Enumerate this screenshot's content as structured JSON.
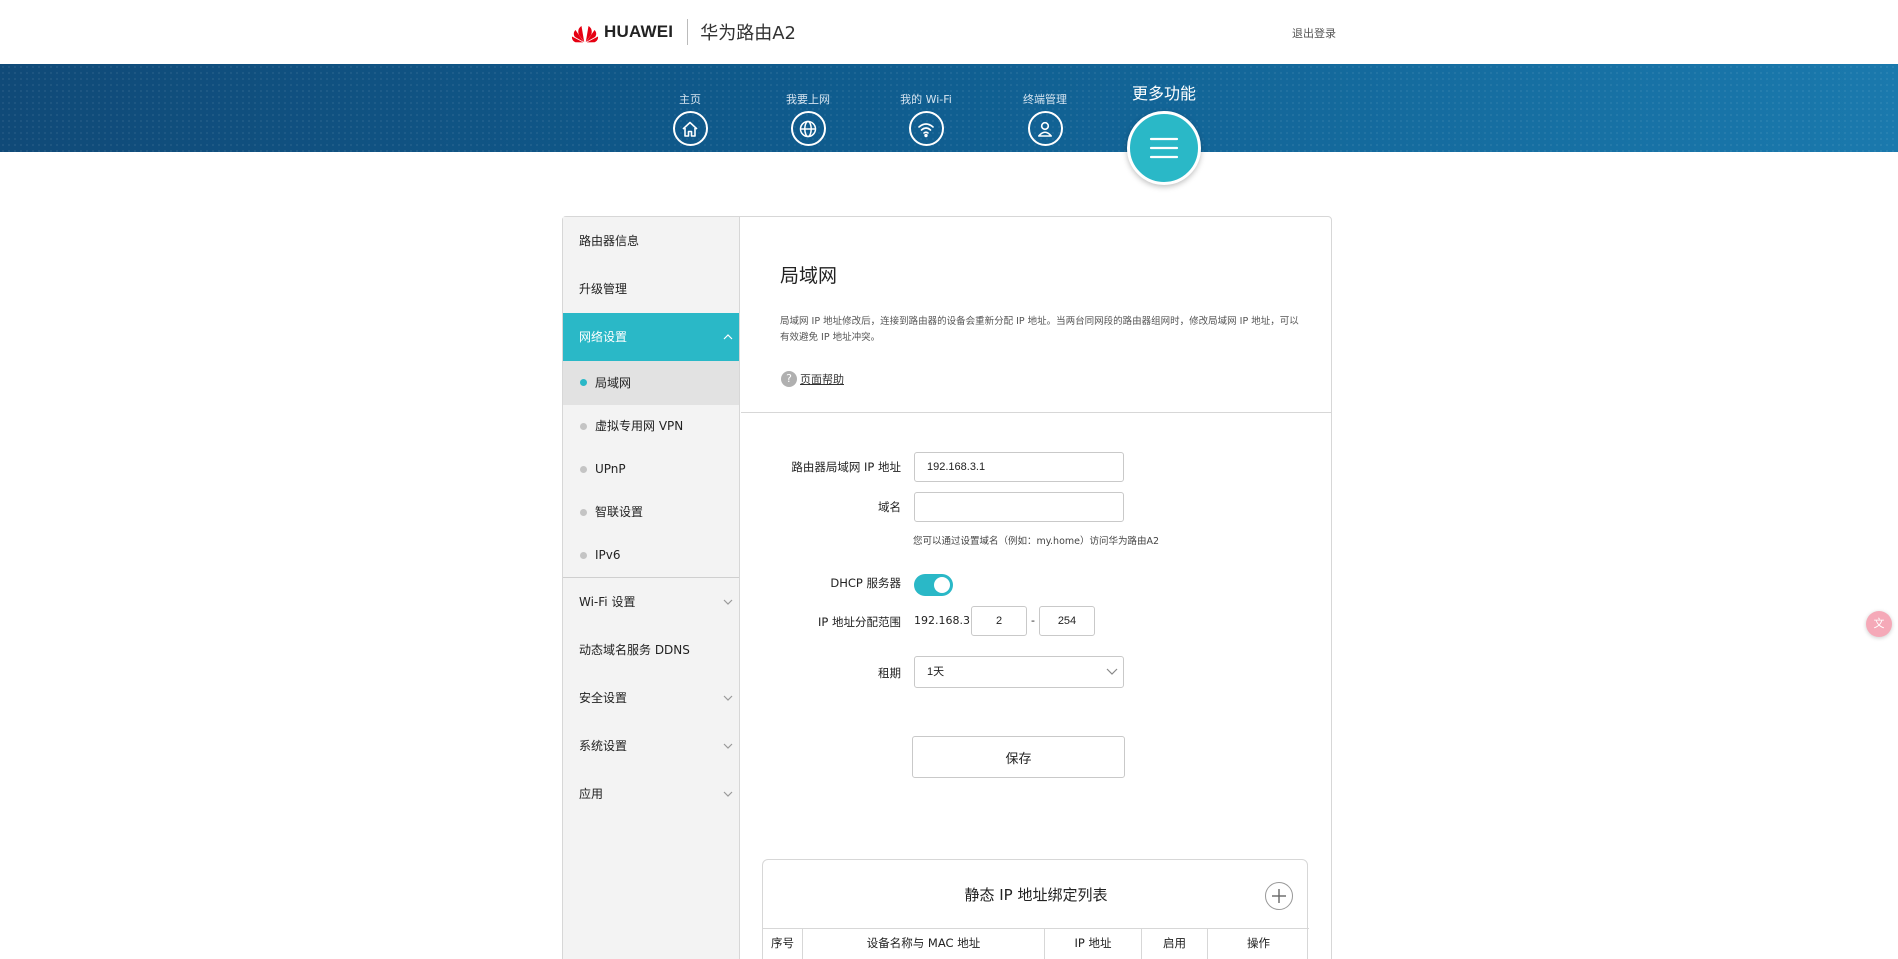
{
  "header": {
    "brand": "HUAWEI",
    "model": "华为路由A2",
    "logout": "退出登录"
  },
  "nav": {
    "items": [
      {
        "label": "主页",
        "icon": "home-icon"
      },
      {
        "label": "我要上网",
        "icon": "globe-icon"
      },
      {
        "label": "我的 Wi-Fi",
        "icon": "wifi-icon"
      },
      {
        "label": "终端管理",
        "icon": "user-icon"
      }
    ],
    "more": {
      "label": "更多功能",
      "icon": "menu-icon"
    }
  },
  "sidebar": {
    "items": [
      {
        "label": "路由器信息"
      },
      {
        "label": "升级管理"
      },
      {
        "label": "网络设置",
        "expanded": true
      },
      {
        "label": "Wi-Fi 设置"
      },
      {
        "label": "动态域名服务 DDNS"
      },
      {
        "label": "安全设置"
      },
      {
        "label": "系统设置"
      },
      {
        "label": "应用"
      }
    ],
    "subitems": [
      {
        "label": "局域网",
        "current": true
      },
      {
        "label": "虚拟专用网 VPN"
      },
      {
        "label": "UPnP"
      },
      {
        "label": "智联设置"
      },
      {
        "label": "IPv6"
      }
    ]
  },
  "main": {
    "title": "局域网",
    "description": "局域网 IP 地址修改后，连接到路由器的设备会重新分配 IP 地址。当两台同网段的路由器组网时，修改局域网 IP 地址，可以有效避免 IP 地址冲突。",
    "help": "页面帮助",
    "form": {
      "ip_label": "路由器局域网 IP 地址",
      "ip_value": "192.168.3.1",
      "domain_label": "域名",
      "domain_value": "",
      "domain_hint": "您可以通过设置域名（例如：my.home）访问华为路由A2",
      "dhcp_label": "DHCP 服务器",
      "dhcp_enabled": true,
      "range_label": "IP 地址分配范围",
      "range_prefix": "192.168.3.",
      "range_start": "2",
      "range_sep": "-",
      "range_end": "254",
      "lease_label": "租期",
      "lease_value": "1天",
      "save": "保存"
    },
    "static_table": {
      "title": "静态 IP 地址绑定列表",
      "columns": [
        "序号",
        "设备名称与 MAC 地址",
        "IP 地址",
        "启用",
        "操作"
      ]
    }
  },
  "floating_badge": "文",
  "colors": {
    "accent": "#2ab8c7",
    "nav_dark": "#104a78",
    "nav_light": "#1a79ad",
    "brand_red": "#e60012"
  }
}
